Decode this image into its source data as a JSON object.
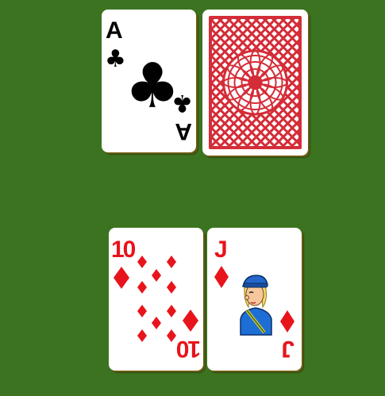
{
  "table": {
    "felt_color": "#3c7320"
  },
  "dealer": {
    "cards": [
      {
        "rank": "A",
        "suit": "clubs",
        "suit_glyph": "♣",
        "color": "#000000",
        "face_up": true
      },
      {
        "face_up": false,
        "back_color": "#d42d38"
      }
    ]
  },
  "player": {
    "cards": [
      {
        "rank": "10",
        "suit": "diamonds",
        "suit_glyph": "♦",
        "color": "#e8141c",
        "face_up": true
      },
      {
        "rank": "J",
        "suit": "diamonds",
        "suit_glyph": "♦",
        "color": "#e8141c",
        "face_up": true
      }
    ]
  }
}
